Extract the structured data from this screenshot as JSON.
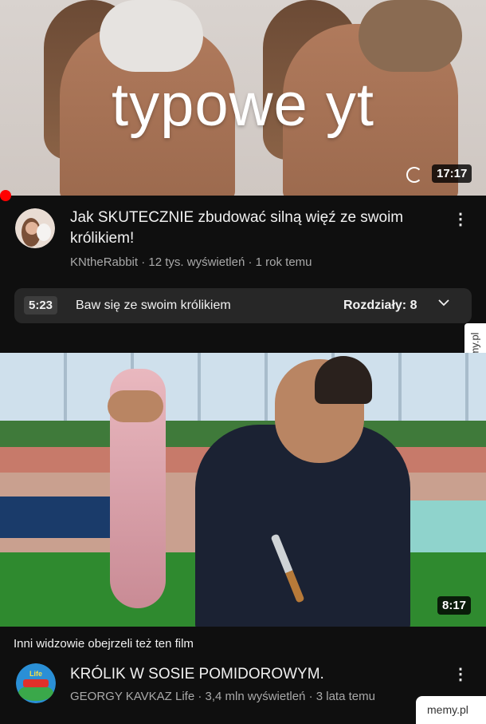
{
  "video1": {
    "overlay_text": "typowe yt",
    "duration": "17:17",
    "title": "Jak SKUTECZNIE zbudować silną więź ze swoim królikiem!",
    "channel": "KNtheRabbit",
    "views": "12 tys. wyświetleń",
    "age": "1 rok temu",
    "meta_sep": " · ",
    "chapter": {
      "time": "5:23",
      "name": "Baw się ze swoim królikiem",
      "chapters_label": "Rozdziały: 8"
    }
  },
  "section_header": "Inni widzowie obejrzeli też ten film",
  "video2": {
    "duration": "8:17",
    "title": "KRÓLIK W SOSIE POMIDOROWYM.",
    "channel": "GEORGY KAVKAZ Life",
    "views": "3,4 mln wyświetleń",
    "age": "3 lata temu",
    "meta_sep": " · ",
    "avatar_text": "Life GEORGY KAVKAZ"
  },
  "watermarks": {
    "side": "memy.pl",
    "corner": "memy.pl"
  },
  "icons": {
    "more": "vertical-ellipsis",
    "chevron": "chevron-down",
    "loading": "spinner"
  },
  "colors": {
    "background": "#0f0f0f",
    "accent_red": "#ff0000",
    "meta_text": "#a9a9a9"
  }
}
